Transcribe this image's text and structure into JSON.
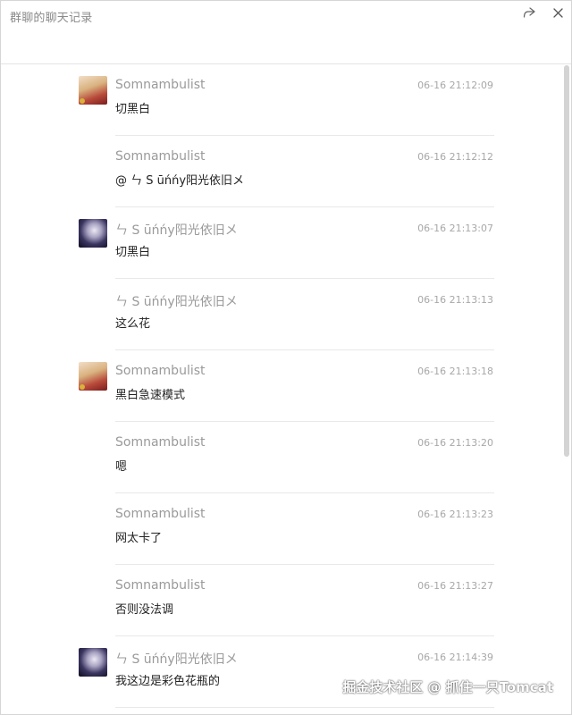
{
  "window": {
    "title": "群聊的聊天记录"
  },
  "messages": [
    {
      "sender": "Somnambulist",
      "time": "06-16 21:12:09",
      "text": "切黑白",
      "avatar": "somnambulist-avatar"
    },
    {
      "sender": "Somnambulist",
      "time": "06-16 21:12:12",
      "text": "@ ㄣ S ūńńy阳光依旧メ",
      "avatar": ""
    },
    {
      "sender": "ㄣ S ūńńy阳光依旧メ",
      "time": "06-16 21:13:07",
      "text": "切黑白",
      "avatar": "sunny-avatar"
    },
    {
      "sender": "ㄣ S ūńńy阳光依旧メ",
      "time": "06-16 21:13:13",
      "text": "这么花",
      "avatar": ""
    },
    {
      "sender": "Somnambulist",
      "time": "06-16 21:13:18",
      "text": "黑白急速模式",
      "avatar": "somnambulist-avatar"
    },
    {
      "sender": "Somnambulist",
      "time": "06-16 21:13:20",
      "text": "嗯",
      "avatar": ""
    },
    {
      "sender": "Somnambulist",
      "time": "06-16 21:13:23",
      "text": "网太卡了",
      "avatar": ""
    },
    {
      "sender": "Somnambulist",
      "time": "06-16 21:13:27",
      "text": "否则没法调",
      "avatar": ""
    },
    {
      "sender": "ㄣ S ūńńy阳光依旧メ",
      "time": "06-16 21:14:39",
      "text": "我这边是彩色花瓶的",
      "avatar": "sunny-avatar"
    }
  ],
  "watermark": "掘金技术社区 @ 抓住一只Tomcat",
  "icons": {
    "share": "share-icon",
    "close": "close-icon"
  }
}
